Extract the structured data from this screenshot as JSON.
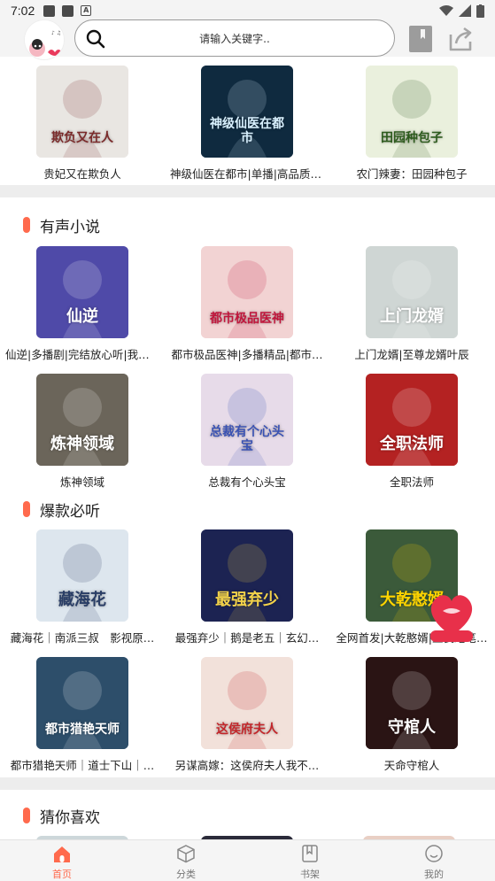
{
  "status_bar": {
    "time": "7:02",
    "a_icon": "A"
  },
  "header": {
    "search_placeholder": "请输入关键字..",
    "avatar_label": "头像"
  },
  "top_row": [
    {
      "title": "贵妃又在欺负人",
      "cover_text": "欺负又在人",
      "bg": "#e9e6e2",
      "accent": "#7a2a2a"
    },
    {
      "title": "神级仙医在都市|单播|高品质|…",
      "cover_text": "神级仙医在都市",
      "bg": "#0f2a3f",
      "accent": "#d9f1ff"
    },
    {
      "title": "农门辣妻：田园种包子",
      "cover_text": "田园种包子",
      "bg": "#eaf0dd",
      "accent": "#2c5a1c"
    }
  ],
  "sections": [
    {
      "title": "有声小说",
      "rows": [
        [
          {
            "title": "仙逆|多播剧|完结放心听|我欲…",
            "cover_text": "仙逆",
            "bg": "#4f4aa8",
            "accent": "#ffffff"
          },
          {
            "title": "都市极品医神|多播精品|都市…",
            "cover_text": "都市极品医神",
            "bg": "#f2d3d3",
            "accent": "#c0163c"
          },
          {
            "title": "上门龙婿|至尊龙婿叶辰",
            "cover_text": "上门龙婿",
            "bg": "#cfd6d4",
            "accent": "#ffffff"
          }
        ],
        [
          {
            "title": "炼神领域",
            "cover_text": "炼神领域",
            "bg": "#6b655a",
            "accent": "#ffffff"
          },
          {
            "title": "总裁有个心头宝",
            "cover_text": "总裁有个心头宝",
            "bg": "#e7dbe9",
            "accent": "#3a52b3"
          },
          {
            "title": "全职法师",
            "cover_text": "全职法师",
            "bg": "#b42222",
            "accent": "#ffffff"
          }
        ]
      ]
    },
    {
      "title": "爆款必听",
      "rows": [
        [
          {
            "title": "藏海花｜南派三叔　影视原…",
            "cover_text": "藏海花",
            "bg": "#dde6ee",
            "accent": "#2a3e66"
          },
          {
            "title": "最强弃少｜鹅是老五｜玄幻…",
            "cover_text": "最强弃少",
            "bg": "#1c2352",
            "accent": "#f3d24a"
          },
          {
            "title": "全网首发|大乾憨婿|玉良绝笔…",
            "cover_text": "大乾憨婿",
            "bg": "#3b5a3a",
            "accent": "#ffd400"
          }
        ],
        [
          {
            "title": "都市猎艳天师｜道士下山｜…",
            "cover_text": "都市猎艳天师",
            "bg": "#2d4e6a",
            "accent": "#ffffff"
          },
          {
            "title": "另谋高嫁：这侯府夫人我不…",
            "cover_text": "这侯府夫人",
            "bg": "#f2e1da",
            "accent": "#c2262a"
          },
          {
            "title": "天命守棺人",
            "cover_text": "守棺人",
            "bg": "#2a1414",
            "accent": "#ffffff"
          }
        ]
      ]
    },
    {
      "title": "猜你喜欢",
      "rows": []
    }
  ],
  "nav": [
    {
      "label": "首页",
      "icon": "home-icon",
      "active": true
    },
    {
      "label": "分类",
      "icon": "cube-icon",
      "active": false
    },
    {
      "label": "书架",
      "icon": "bookshelf-icon",
      "active": false
    },
    {
      "label": "我的",
      "icon": "profile-icon",
      "active": false
    }
  ],
  "colors": {
    "accent": "#ff6a4d",
    "divider": "#ededed"
  }
}
